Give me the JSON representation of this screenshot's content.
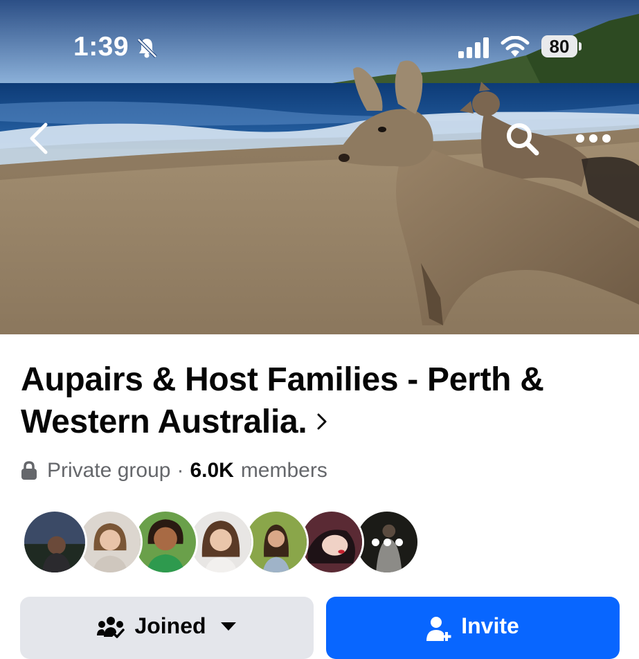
{
  "status_bar": {
    "time": "1:39",
    "battery_percent": "80",
    "icons": [
      "bell-slash-icon",
      "cellular-signal-icon",
      "wifi-icon",
      "battery-icon"
    ]
  },
  "header": {
    "icons": [
      "back-chevron-icon",
      "search-icon",
      "more-icon"
    ]
  },
  "group": {
    "title": "Aupairs & Host Families - Perth & Western Australia.",
    "privacy": "Private group",
    "separator": "·",
    "member_count": "6.0K",
    "members_label": "members"
  },
  "member_avatars": {
    "count_shown": 7,
    "last_is_more": true
  },
  "actions": {
    "joined_label": "Joined",
    "invite_label": "Invite"
  },
  "colors": {
    "primary_blue": "#0866ff",
    "secondary_gray": "#e4e6eb",
    "text_primary": "#050505",
    "text_secondary": "#65676b"
  }
}
